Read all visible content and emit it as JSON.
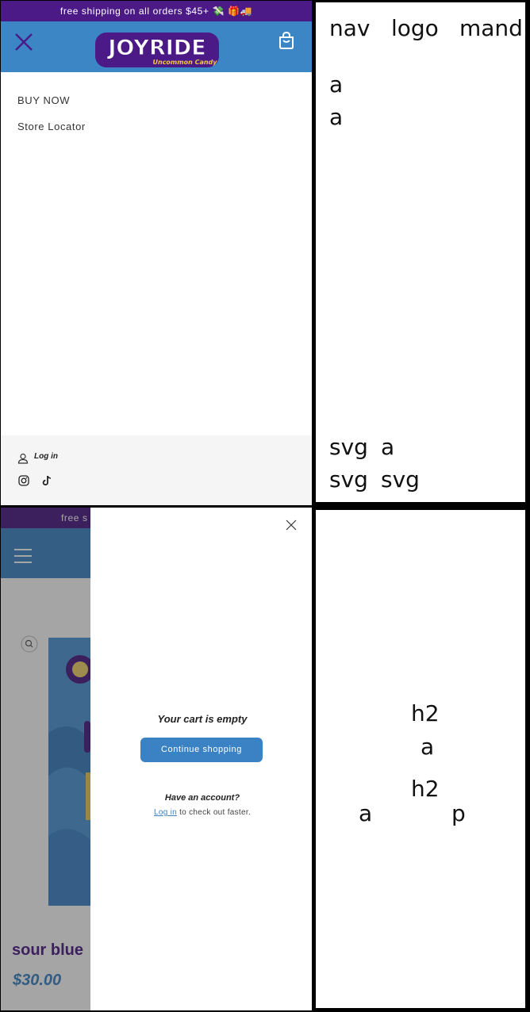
{
  "top_panel": {
    "banner": "free shipping on all orders $45+ 💸 🎁🚚",
    "logo": {
      "main": "JOYRIDE",
      "sub": "Uncommon Candy"
    },
    "menu": [
      "BUY NOW",
      "Store Locator"
    ],
    "login": "Log in"
  },
  "bottom_panel": {
    "banner": "free s",
    "product_title": "sour blue",
    "price": "$30.00",
    "cart_empty": "Your cart is empty",
    "continue": "Continue shopping",
    "have_account": "Have an account?",
    "login_link": "Log in",
    "login_suffix": " to check out faster."
  },
  "labels_top": [
    "nav",
    "logo",
    "mand",
    "a",
    "a",
    "svg",
    "a",
    "svg",
    "svg"
  ],
  "labels_bottom": [
    "h2",
    "a",
    "h2",
    "a",
    "p"
  ],
  "colors": {
    "brand_purple": "#4b1a86",
    "brand_blue": "#3d86c6",
    "button": "#3b82c4"
  }
}
